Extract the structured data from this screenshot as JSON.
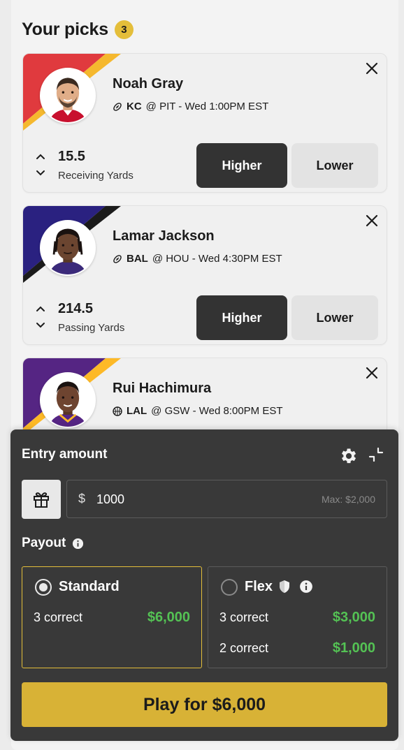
{
  "header": {
    "title": "Your picks",
    "count": "3"
  },
  "picks": [
    {
      "player": "Noah Gray",
      "team": "KC",
      "matchup": "@ PIT - Wed 1:00PM EST",
      "sport_icon": "football-icon",
      "line": "15.5",
      "stat": "Receiving Yards",
      "higher_label": "Higher",
      "lower_label": "Lower",
      "stripe_colors": [
        "#e03a3e",
        "#f5b82e"
      ]
    },
    {
      "player": "Lamar Jackson",
      "team": "BAL",
      "matchup": "@ HOU - Wed 4:30PM EST",
      "sport_icon": "football-icon",
      "line": "214.5",
      "stat": "Passing Yards",
      "higher_label": "Higher",
      "lower_label": "Lower",
      "stripe_colors": [
        "#2a2180",
        "#1b1b1b"
      ]
    },
    {
      "player": "Rui Hachimura",
      "team": "LAL",
      "matchup": "@ GSW - Wed 8:00PM EST",
      "sport_icon": "basketball-icon",
      "stripe_colors": [
        "#552583",
        "#fdb927"
      ]
    }
  ],
  "entry": {
    "title": "Entry amount",
    "currency": "$",
    "amount": "1000",
    "max": "Max: $2,000"
  },
  "payout": {
    "label": "Payout",
    "standard": {
      "name": "Standard",
      "rows": [
        {
          "label": "3 correct",
          "value": "$6,000"
        }
      ]
    },
    "flex": {
      "name": "Flex",
      "rows": [
        {
          "label": "3 correct",
          "value": "$3,000"
        },
        {
          "label": "2 correct",
          "value": "$1,000"
        }
      ]
    }
  },
  "play_label": "Play for $6,000",
  "colors": {
    "accent": "#e4be3a",
    "play": "#d8b236",
    "payout_green": "#54c254",
    "dark": "#393939"
  }
}
